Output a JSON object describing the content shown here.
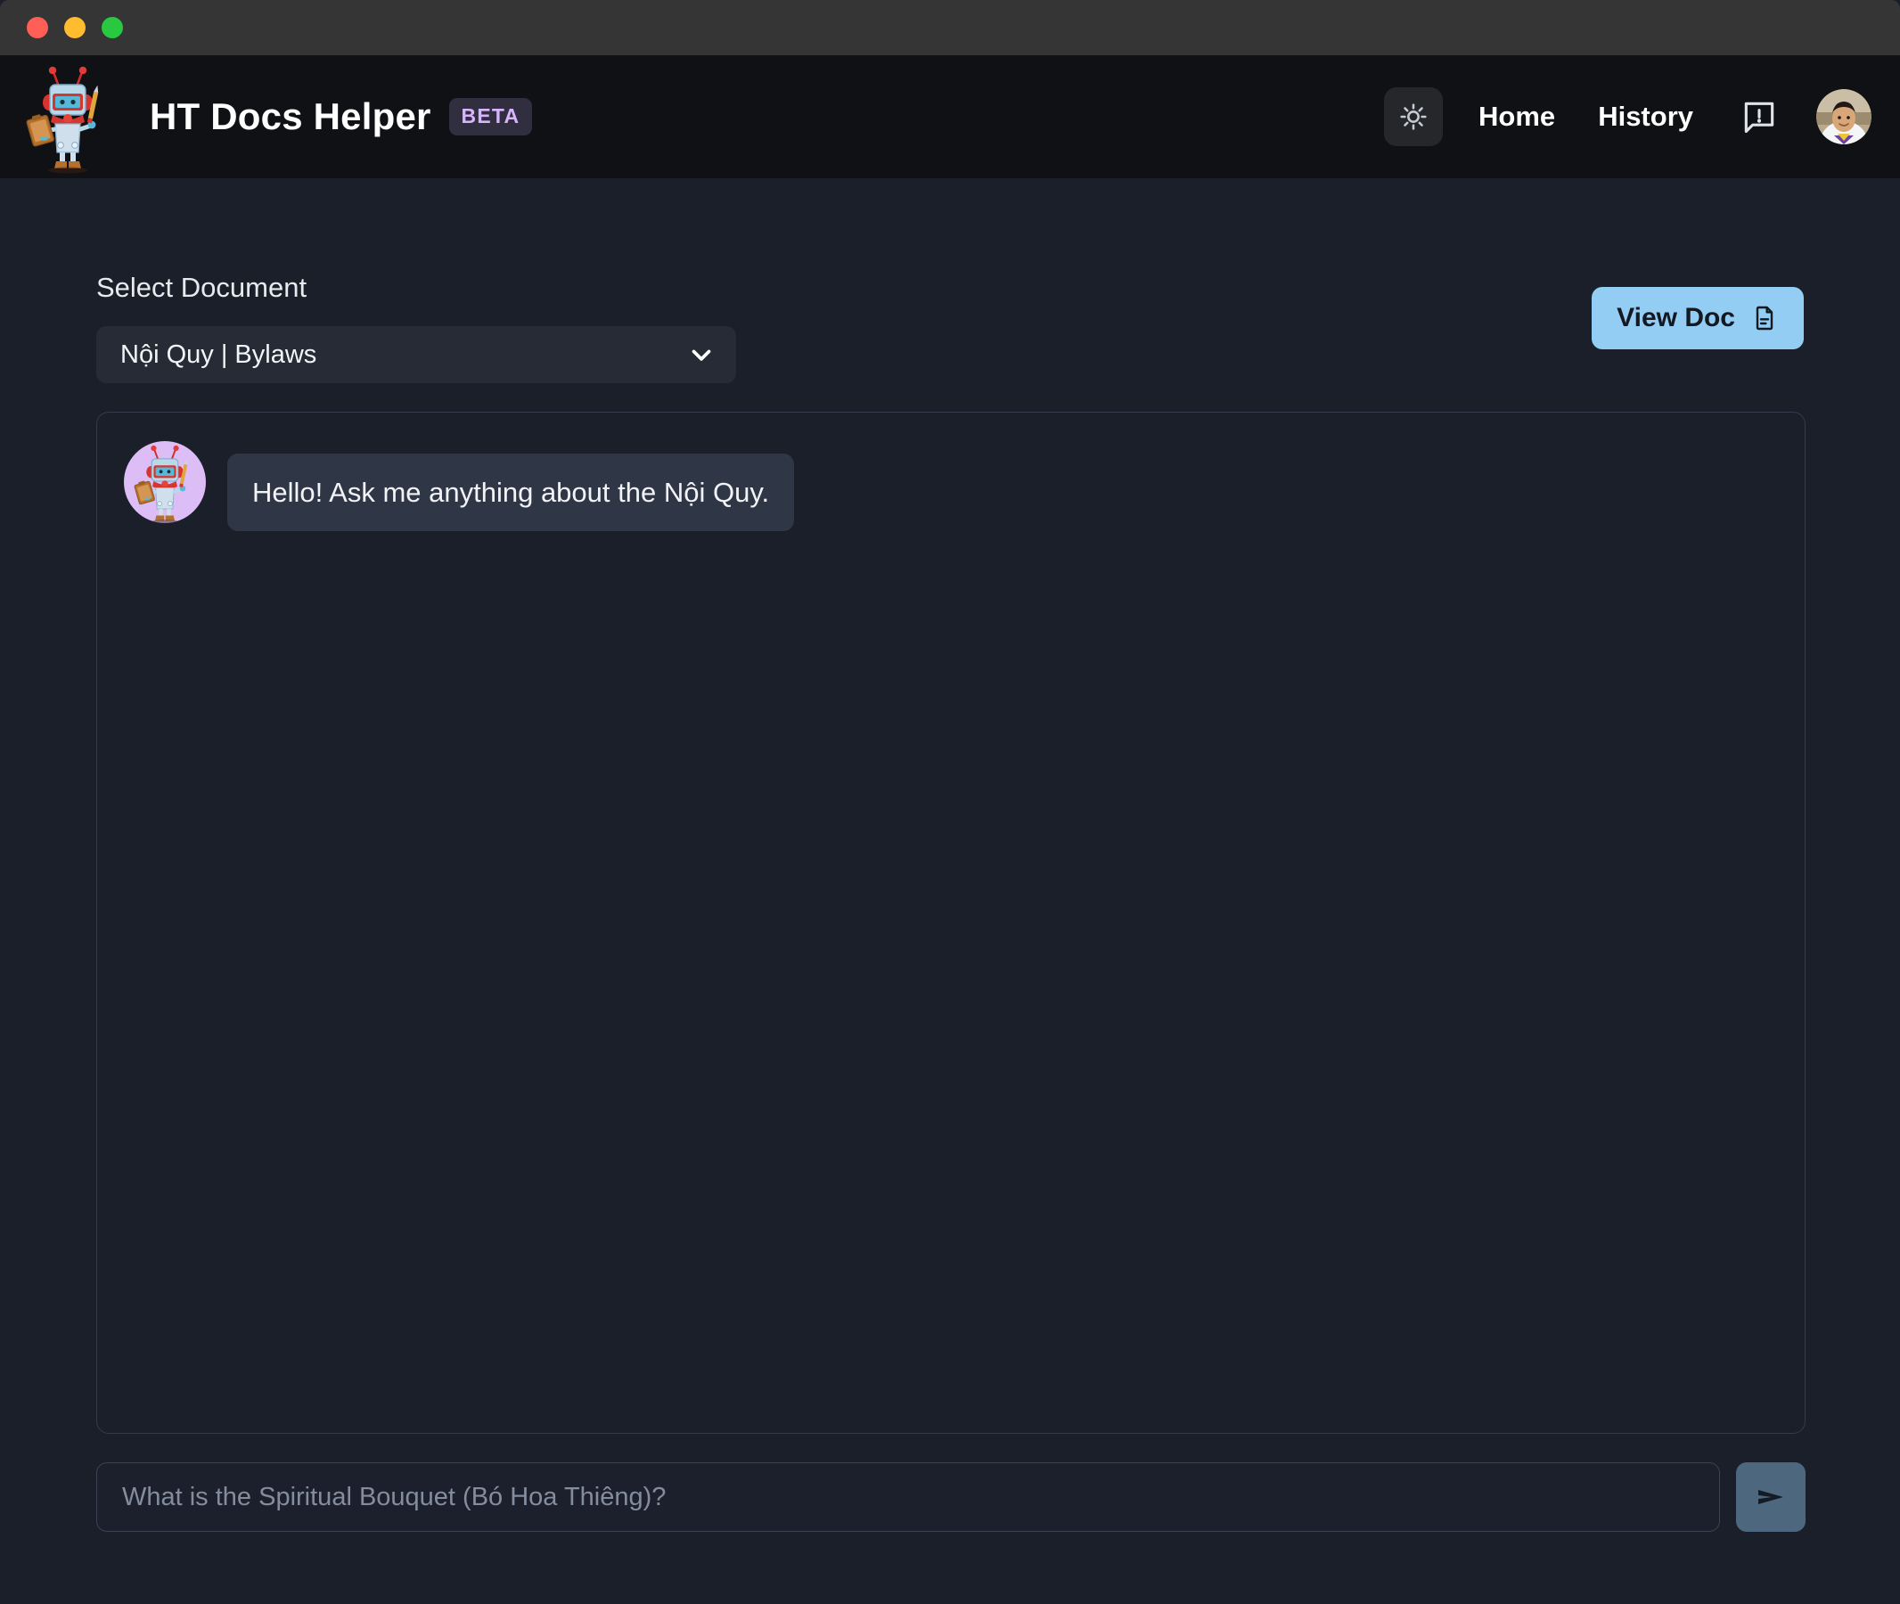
{
  "window": {
    "traffic_lights": [
      {
        "name": "close-button",
        "color": "#ff5f57"
      },
      {
        "name": "minimize-button",
        "color": "#febc2e"
      },
      {
        "name": "maximize-button",
        "color": "#28c840"
      }
    ]
  },
  "header": {
    "logo_icon": "robot-logo-icon",
    "title": "HT Docs Helper",
    "badge": "BETA",
    "theme_toggle_icon": "sun-icon",
    "nav": [
      {
        "label": "Home"
      },
      {
        "label": "History"
      }
    ],
    "feedback_icon": "feedback-speech-bubble-icon",
    "avatar_icon": "user-avatar"
  },
  "document_selector": {
    "label": "Select Document",
    "selected": "Nội Quy | Bylaws",
    "chevron_icon": "chevron-down-icon",
    "options": [
      "Nội Quy | Bylaws"
    ]
  },
  "view_doc": {
    "label": "View Doc",
    "icon": "document-icon"
  },
  "chat": {
    "messages": [
      {
        "author": "bot",
        "avatar_icon": "robot-avatar-icon",
        "text": "Hello! Ask me anything about the Nội Quy."
      }
    ]
  },
  "composer": {
    "value": "",
    "placeholder": "What is the Spiritual Bouquet (Bó Hoa Thiêng)?",
    "send_icon": "send-arrow-icon"
  },
  "colors": {
    "titlebar": "#353535",
    "header_bg": "#101114",
    "page_bg": "#1b1f2a",
    "panel_border": "#343b4b",
    "bubble_bg": "#2f3646",
    "accent_button": "#93cdf4",
    "send_button": "#4d677f",
    "badge_text": "#d8b4fe",
    "badge_bg": "#312e3f",
    "bot_avatar_bg": "#ddbdf5"
  }
}
